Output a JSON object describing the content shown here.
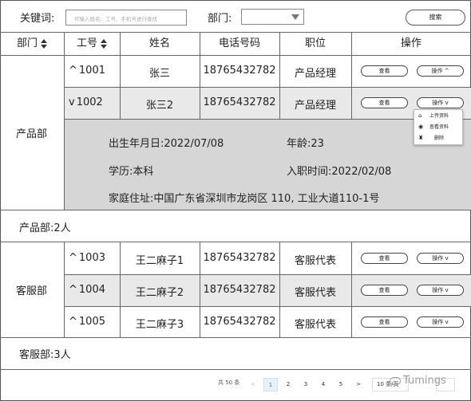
{
  "search": {
    "keyword_label": "关键词:",
    "keyword_placeholder": "可输入姓名、工号、手机号进行查找",
    "dept_label": "部门:",
    "dept_value": "",
    "button": "搜索"
  },
  "columns": {
    "dept": "部门",
    "id": "工号",
    "name": "姓名",
    "phone": "电话号码",
    "position": "职位",
    "actions": "操作"
  },
  "groups": [
    {
      "dept": "产品部",
      "summary": "产品部:2人",
      "rows": [
        {
          "id": "1001",
          "chevron": "^",
          "name": "张三",
          "phone": "18765432782",
          "position": "产品经理",
          "view": "查看",
          "op": "操作 ^"
        },
        {
          "id": "1002",
          "chevron": "v",
          "name": "张三2",
          "phone": "18765432782",
          "position": "产品经理",
          "view": "查看",
          "op": "操作 v"
        }
      ],
      "detail": {
        "birth": "出生年月日:2022/07/08",
        "age": "年龄:23",
        "education": "学历:本科",
        "hire_date": "入职时间:2022/02/08",
        "address": "家庭住址:中国广东省深圳市龙岗区 110, 工业大道110-1号"
      }
    },
    {
      "dept": "客服部",
      "summary": "客服部:3人",
      "rows": [
        {
          "id": "1003",
          "chevron": "^",
          "name": "王二麻子1",
          "phone": "18765432782",
          "position": "客服代表",
          "view": "查看",
          "op": "操作 v"
        },
        {
          "id": "1004",
          "chevron": "^",
          "name": "王二麻子2",
          "phone": "18765432782",
          "position": "客服代表",
          "view": "查看",
          "op": "操作 v"
        },
        {
          "id": "1005",
          "chevron": "^",
          "name": "王二麻子3",
          "phone": "18765432782",
          "position": "客服代表",
          "view": "查看",
          "op": "操作 v"
        }
      ]
    }
  ],
  "dropdown": {
    "items": [
      {
        "label": "上传资料",
        "icon": "upload-icon",
        "glyph": "⌂"
      },
      {
        "label": "查看资料",
        "icon": "eye-icon",
        "glyph": "◉"
      },
      {
        "label": "删除",
        "icon": "trash-icon",
        "glyph": "♜"
      }
    ]
  },
  "pagination": {
    "total": "共 50 条",
    "prev": "<",
    "pages": [
      "1",
      "2",
      "3",
      "4",
      "5"
    ],
    "next": ">",
    "page_size": "10 条/页",
    "current": "1"
  },
  "watermark": "Tumings",
  "colors": {
    "border": "#666666",
    "row_alt": "#e9e9e9",
    "detail_bg": "#d6d6d6",
    "active_page": "#3a74c8"
  }
}
